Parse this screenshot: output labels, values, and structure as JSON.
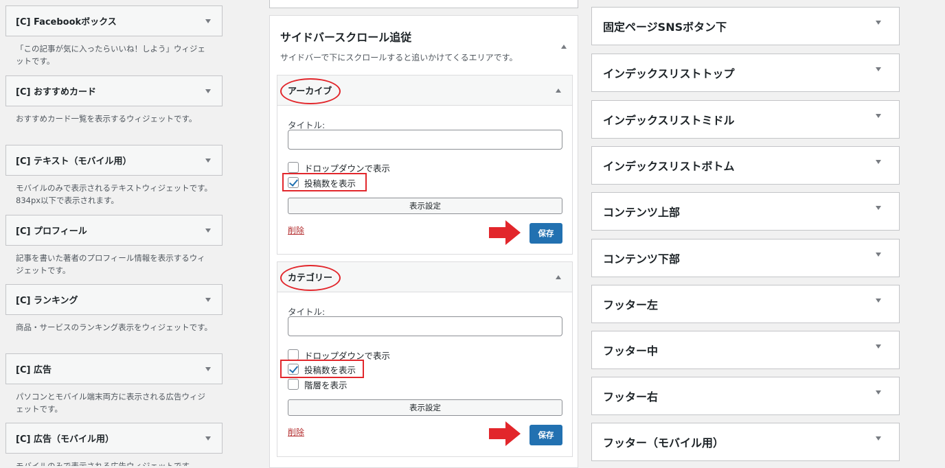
{
  "left_widgets": [
    {
      "title": "[C] Facebookボックス",
      "description": "「この記事が気に入ったらいいね！しよう」ウィジェットです。"
    },
    {
      "title": "[C] おすすめカード",
      "description": "おすすめカード一覧を表示するウィジェットです。"
    },
    {
      "title": "[C] テキスト（モバイル用）",
      "description": "モバイルのみで表示されるテキストウィジェットです。834px以下で表示されます。"
    },
    {
      "title": "[C] プロフィール",
      "description": "記事を書いた著者のプロフィール情報を表示するウィジェットです。"
    },
    {
      "title": "[C] ランキング",
      "description": "商品・サービスのランキング表示をウィジェットです。"
    },
    {
      "title": "[C] 広告",
      "description": "パソコンとモバイル端末両方に表示される広告ウィジェットです。"
    },
    {
      "title": "[C] 広告（モバイル用）",
      "description": "モバイルのみで表示される広告ウィジェットです。"
    }
  ],
  "sidebar_area": {
    "title": "サイドバースクロール追従",
    "description": "サイドバーで下にスクロールすると追いかけてくるエリアです。"
  },
  "archive_widget": {
    "title": "アーカイブ",
    "title_label": "タイトル:",
    "title_value": "",
    "dropdown_label": "ドロップダウンで表示",
    "dropdown_checked": false,
    "count_label": "投稿数を表示",
    "count_checked": true,
    "display_settings": "表示設定",
    "delete": "削除",
    "save": "保存"
  },
  "category_widget": {
    "title": "カテゴリー",
    "title_label": "タイトル:",
    "title_value": "",
    "dropdown_label": "ドロップダウンで表示",
    "dropdown_checked": false,
    "count_label": "投稿数を表示",
    "count_checked": true,
    "hierarchy_label": "階層を表示",
    "hierarchy_checked": false,
    "display_settings": "表示設定",
    "delete": "削除",
    "save": "保存"
  },
  "right_areas": [
    "固定ページSNSボタン下",
    "インデックスリストトップ",
    "インデックスリストミドル",
    "インデックスリストボトム",
    "コンテンツ上部",
    "コンテンツ下部",
    "フッター左",
    "フッター中",
    "フッター右",
    "フッター（モバイル用）"
  ],
  "colors": {
    "annotation_red": "#e2262b",
    "primary_blue": "#2271b1",
    "delete_red": "#b32d2e"
  }
}
